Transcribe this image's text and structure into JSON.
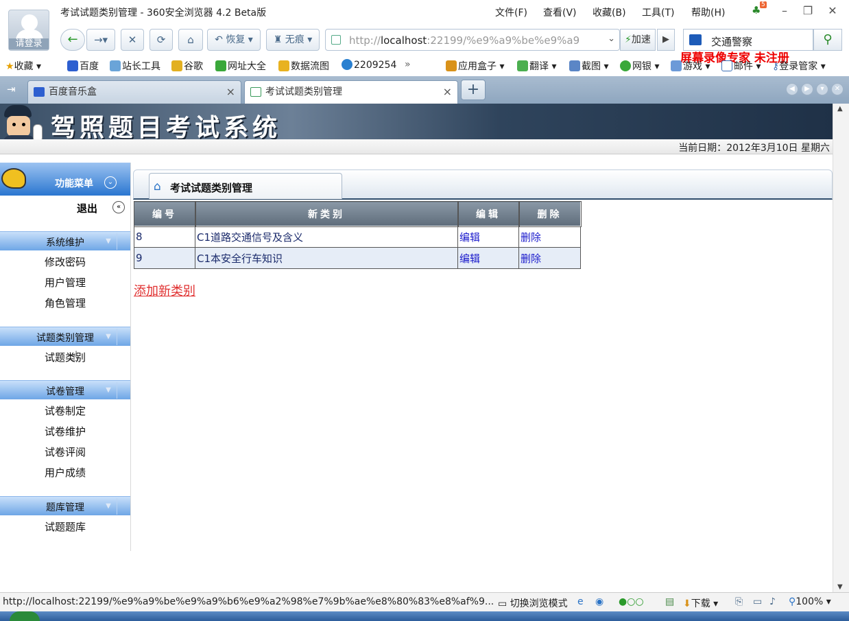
{
  "window": {
    "title": "考试试题类别管理 - 360安全浏览器 4.2 Beta版",
    "avatar_label": "请登录",
    "menus": [
      "文件(F)",
      "查看(V)",
      "收藏(B)",
      "工具(T)",
      "帮助(H)"
    ],
    "notify_count": "5"
  },
  "nav": {
    "restore_label": "恢复",
    "incognito_label": "无痕",
    "url_prefix": "http://",
    "url_host": "localhost",
    "url_rest": ":22199/%e9%a9%be%e9%a9",
    "accel_label": "加速",
    "search_value": "交通警察",
    "watermark": "屏幕录像专家  未注册"
  },
  "favorites": {
    "collect": "收藏",
    "items": [
      "百度",
      "站长工具",
      "谷歌",
      "网址大全",
      "数据流图",
      "2209254"
    ],
    "more": "»",
    "right_items": [
      "应用盒子",
      "翻译",
      "截图",
      "网银",
      "游戏",
      "邮件",
      "登录管家"
    ]
  },
  "tabs": [
    {
      "label": "百度音乐盒",
      "active": false
    },
    {
      "label": "考试试题类别管理",
      "active": true
    }
  ],
  "page": {
    "banner_title": "驾照题目考试系统",
    "date_label": "当前日期：",
    "date_value": "2012年3月10日  星期六",
    "sidebar": {
      "header": "功能菜单",
      "exit": "退出",
      "groups": [
        {
          "title": "系统维护",
          "items": [
            "修改密码",
            "用户管理",
            "角色管理"
          ]
        },
        {
          "title": "试题类别管理",
          "items": [
            "试题类别"
          ]
        },
        {
          "title": "试卷管理",
          "items": [
            "试卷制定",
            "试卷维护",
            "试卷评阅",
            "用户成绩"
          ]
        },
        {
          "title": "题库管理",
          "items": [
            "试题题库"
          ]
        }
      ]
    },
    "main_tab": "考试试题类别管理",
    "table": {
      "headers": [
        "编号",
        "新类别",
        "编辑",
        "删除"
      ],
      "rows": [
        {
          "id": "8",
          "name": "C1道路交通信号及含义",
          "edit": "编辑",
          "delete": "删除"
        },
        {
          "id": "9",
          "name": "C1本安全行车知识",
          "edit": "编辑",
          "delete": "删除"
        }
      ]
    },
    "add_link": "添加新类别"
  },
  "status": {
    "url": "http://localhost:22199/%e9%a9%be%e9%a9%b6%e9%a2%98%e7%9b%ae%e8%80%83%e8%af%9...",
    "mode": "切换浏览模式",
    "download": "下载",
    "zoom": "100%"
  }
}
